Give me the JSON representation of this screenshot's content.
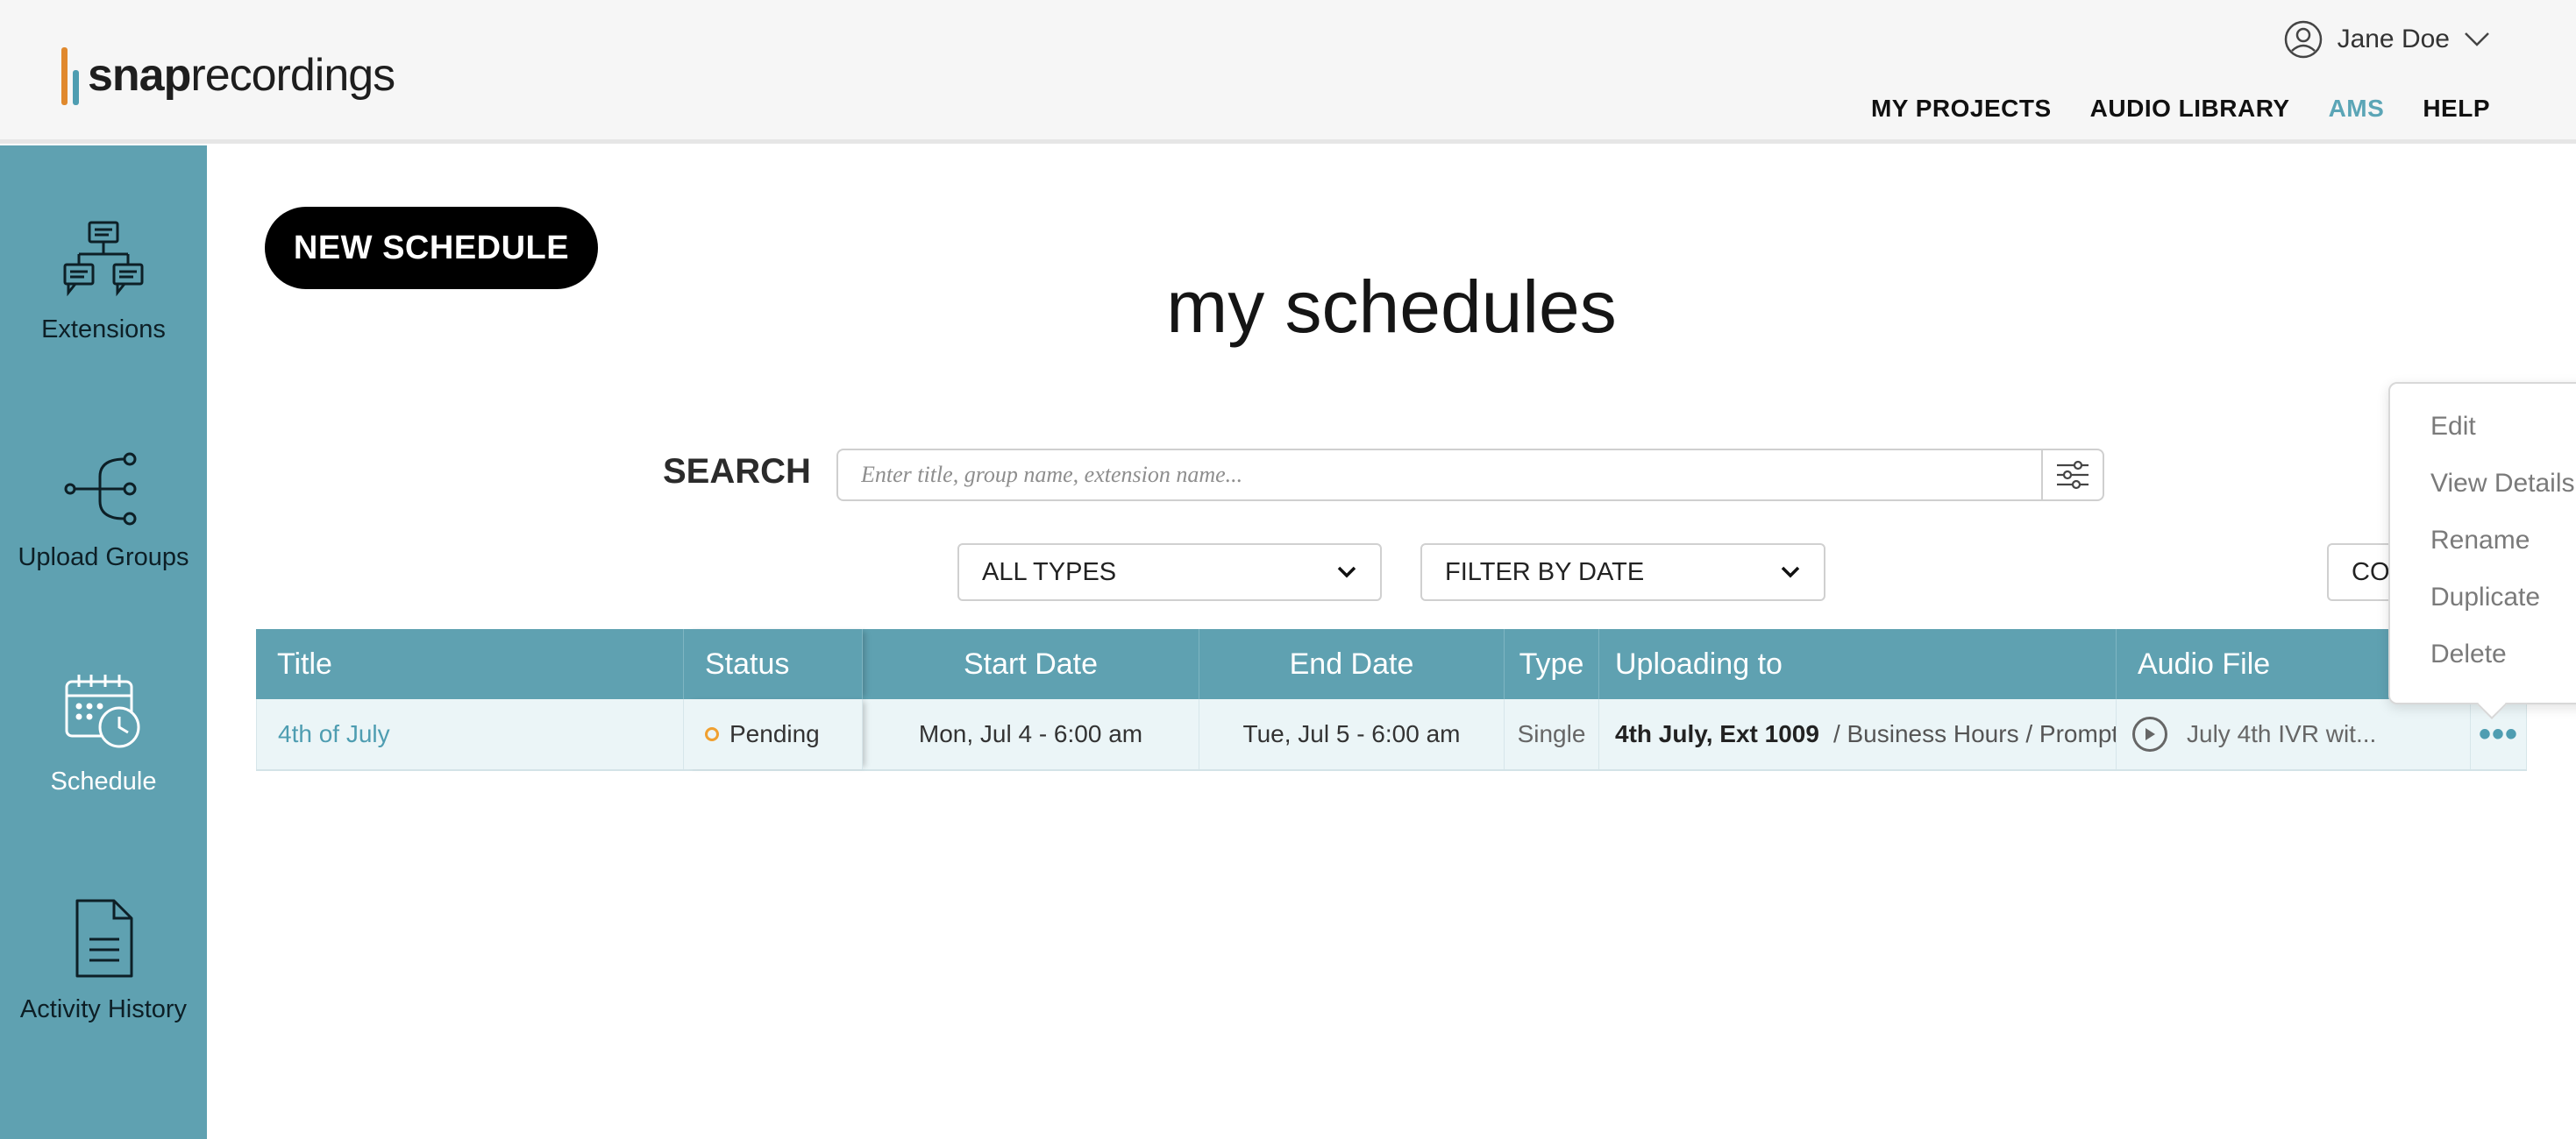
{
  "brand": {
    "logo_part1": "snap",
    "logo_part2": "recordings"
  },
  "user": {
    "name": "Jane Doe"
  },
  "nav": [
    {
      "label": "MY PROJECTS"
    },
    {
      "label": "AUDIO LIBRARY"
    },
    {
      "label": "AMS",
      "active": true
    },
    {
      "label": "HELP"
    }
  ],
  "sidebar": {
    "items": [
      {
        "label": "Extensions",
        "icon": "extensions-icon"
      },
      {
        "label": "Upload Groups",
        "icon": "upload-groups-icon"
      },
      {
        "label": "Schedule",
        "icon": "schedule-icon",
        "active": true
      },
      {
        "label": "Activity History",
        "icon": "activity-history-icon"
      }
    ]
  },
  "main": {
    "new_button": "NEW SCHEDULE",
    "title": "my schedules",
    "search_label": "SEARCH",
    "search_placeholder": "Enter title, group name, extension name...",
    "type_filter": "ALL TYPES",
    "date_filter": "FILTER BY DATE",
    "columns_button": "COLUMNS"
  },
  "table": {
    "headers": [
      "Title",
      "Status",
      "Start Date",
      "End Date",
      "Type",
      "Uploading to",
      "Audio File"
    ],
    "rows": [
      {
        "title": "4th of July",
        "status": "Pending",
        "start": "Mon, Jul 4 - 6:00 am",
        "end": "Tue, Jul 5 - 6:00 am",
        "type": "Single",
        "uploading_to_main": "4th July, Ext 1009",
        "uploading_to_path": "/ Business Hours / Prompt",
        "audio": "July 4th IVR wit...",
        "more": "•••"
      }
    ]
  },
  "menu": {
    "items": [
      "Edit",
      "View Details",
      "Rename",
      "Duplicate",
      "Delete"
    ]
  },
  "colors": {
    "accent": "#5fa1b1",
    "link": "#4e9db1",
    "pending": "#f0a030"
  }
}
